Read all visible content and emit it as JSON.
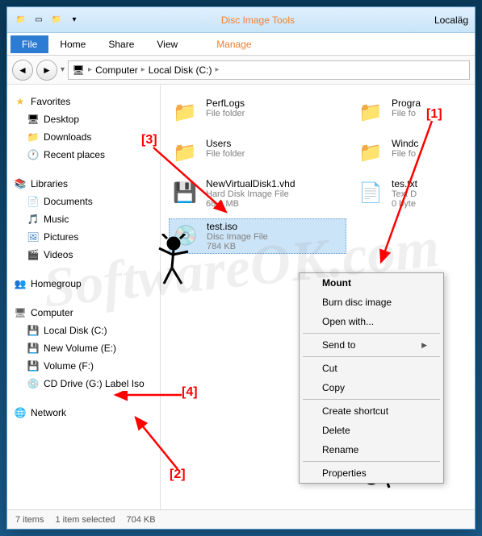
{
  "titlebar": {
    "contextTab": "Disc Image Tools",
    "location": "Localäg"
  },
  "ribbon": {
    "file": "File",
    "home": "Home",
    "share": "Share",
    "view": "View",
    "manage": "Manage"
  },
  "breadcrumb": {
    "root": "Computer",
    "disk": "Local Disk (C:)"
  },
  "sidebar": {
    "favorites": {
      "header": "Favorites",
      "desktop": "Desktop",
      "downloads": "Downloads",
      "recent": "Recent places"
    },
    "libraries": {
      "header": "Libraries",
      "documents": "Documents",
      "music": "Music",
      "pictures": "Pictures",
      "videos": "Videos"
    },
    "homegroup": {
      "header": "Homegroup"
    },
    "computer": {
      "header": "Computer",
      "localC": "Local Disk (C:)",
      "newVolE": "New Volume (E:)",
      "volF": "Volume (F:)",
      "cdG": "CD Drive (G:) Label Iso"
    },
    "network": {
      "header": "Network"
    }
  },
  "files": {
    "perflogs": {
      "name": "PerfLogs",
      "type": "File folder"
    },
    "users": {
      "name": "Users",
      "type": "File folder"
    },
    "vhd": {
      "name": "NewVirtualDisk1.vhd",
      "type": "Hard Disk Image File",
      "size": "68.0 MB"
    },
    "iso": {
      "name": "test.iso",
      "type": "Disc Image File",
      "size": "784 KB"
    },
    "progra": {
      "name": "Progra",
      "type": "File fo"
    },
    "windc": {
      "name": "Windc",
      "type": "File fo"
    },
    "testxt": {
      "name": "tes.txt",
      "type": "Text D",
      "size": "0 byte"
    }
  },
  "contextMenu": {
    "mount": "Mount",
    "burn": "Burn disc image",
    "openWith": "Open with...",
    "sendTo": "Send to",
    "cut": "Cut",
    "copy": "Copy",
    "shortcut": "Create shortcut",
    "delete": "Delete",
    "rename": "Rename",
    "properties": "Properties"
  },
  "statusbar": {
    "count": "7 items",
    "selection": "1 item selected",
    "size": "704 KB"
  },
  "annotations": {
    "a1": "[1]",
    "a2": "[2]",
    "a3": "[3]",
    "a4": "[4]"
  },
  "watermark": "SoftwareOK.com"
}
